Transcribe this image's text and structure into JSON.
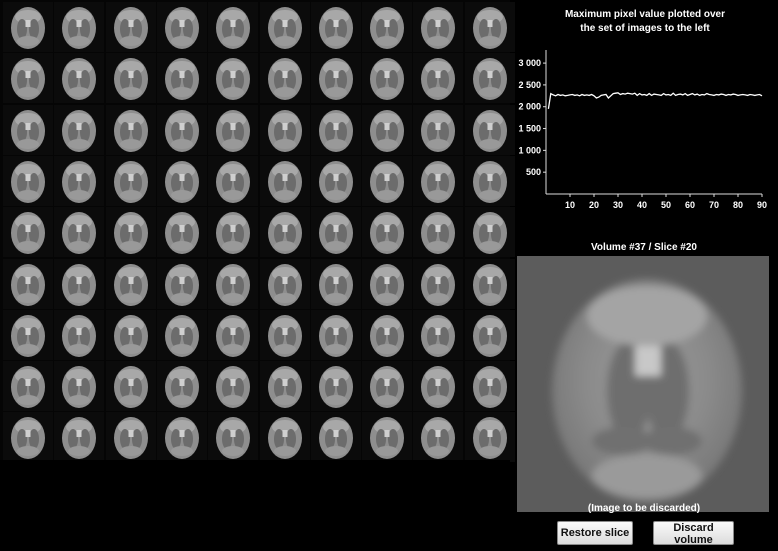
{
  "grid": {
    "rows": 9,
    "cols": 10,
    "selected_white": {
      "row": 1,
      "col": 5
    },
    "selected_green": {
      "row": 3,
      "col": 6
    }
  },
  "chart": {
    "title_line1": "Maximum pixel value plotted over",
    "title_line2": "the set of images to the left"
  },
  "chart_data": {
    "type": "line",
    "title": "",
    "xlabel": "",
    "ylabel": "",
    "xlim": [
      0,
      90
    ],
    "ylim": [
      0,
      3300
    ],
    "x_ticks": [
      10,
      20,
      30,
      40,
      50,
      60,
      70,
      80,
      90
    ],
    "y_ticks": [
      500,
      1000,
      1500,
      2000,
      2500,
      3000
    ],
    "y_tick_labels": [
      "500",
      "1 000",
      "1 500",
      "2 000",
      "2 500",
      "3 000"
    ],
    "series": [
      {
        "color": "#ffffff",
        "x": [
          1,
          2,
          3,
          4,
          5,
          6,
          7,
          8,
          9,
          10,
          11,
          12,
          13,
          14,
          15,
          16,
          17,
          18,
          19,
          20,
          21,
          22,
          23,
          24,
          25,
          26,
          27,
          28,
          29,
          30,
          31,
          32,
          33,
          34,
          35,
          36,
          37,
          38,
          39,
          40,
          41,
          42,
          43,
          44,
          45,
          46,
          47,
          48,
          49,
          50,
          51,
          52,
          53,
          54,
          55,
          56,
          57,
          58,
          59,
          60,
          61,
          62,
          63,
          64,
          65,
          66,
          67,
          68,
          69,
          70,
          71,
          72,
          73,
          74,
          75,
          76,
          77,
          78,
          79,
          80,
          81,
          82,
          83,
          84,
          85,
          86,
          87,
          88,
          89,
          90
        ],
        "values": [
          1950,
          2300,
          2270,
          2250,
          2280,
          2260,
          2270,
          2250,
          2260,
          2270,
          2280,
          2260,
          2270,
          2250,
          2280,
          2260,
          2270,
          2260,
          2280,
          2250,
          2200,
          2220,
          2260,
          2270,
          2280,
          2200,
          2250,
          2300,
          2310,
          2320,
          2280,
          2300,
          2290,
          2310,
          2300,
          2290,
          2310,
          2260,
          2300,
          2270,
          2280,
          2260,
          2300,
          2260,
          2290,
          2280,
          2270,
          2260,
          2300,
          2270,
          2280,
          2260,
          2310,
          2260,
          2280,
          2290,
          2270,
          2300,
          2260,
          2280,
          2300,
          2270,
          2290,
          2260,
          2280,
          2270,
          2300,
          2280,
          2270,
          2260,
          2280,
          2270,
          2290,
          2280,
          2260,
          2280,
          2270,
          2290,
          2280,
          2260,
          2270,
          2280,
          2270,
          2260,
          2280,
          2270,
          2260,
          2270,
          2280,
          2250
        ]
      }
    ]
  },
  "preview": {
    "title": "Volume #37 / Slice #20",
    "caption": "(Image to be discarded)"
  },
  "buttons": {
    "restore_label": "Restore slice",
    "discard_label": "Discard volume"
  }
}
